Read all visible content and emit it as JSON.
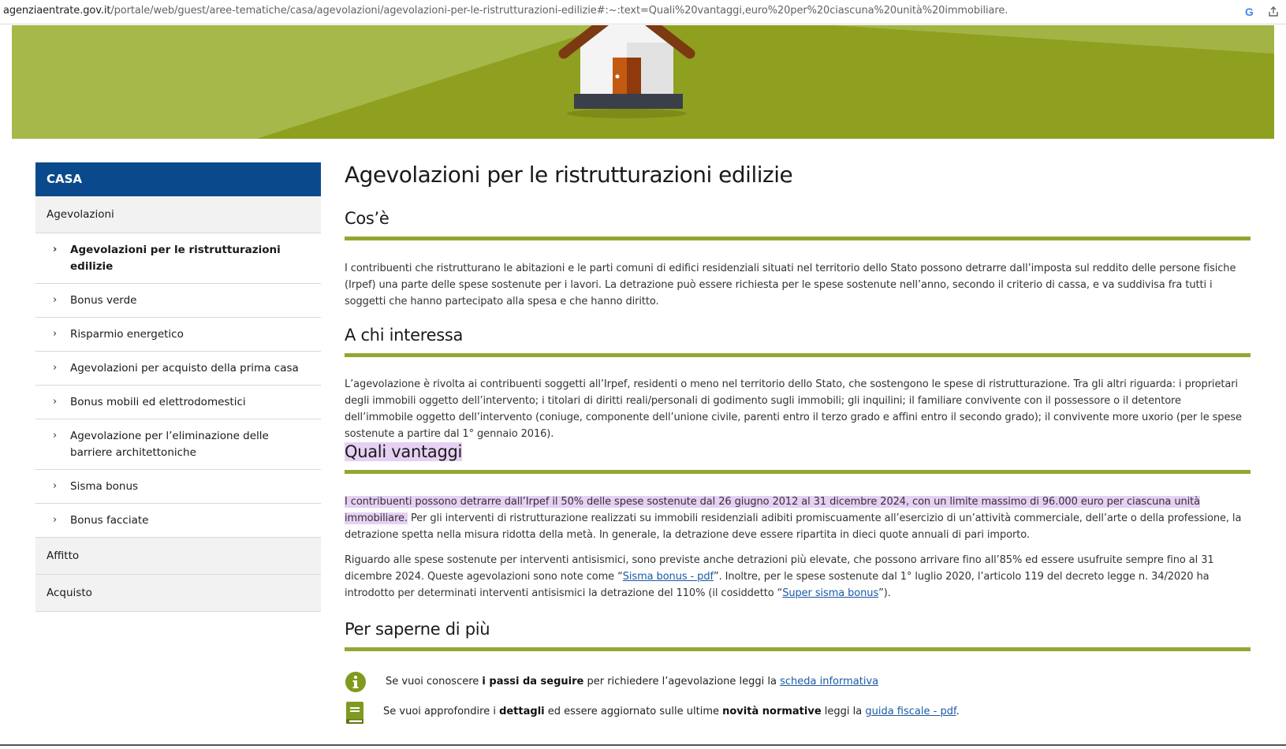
{
  "browser": {
    "url_domain": "agenziaentrate.gov.it",
    "url_path": "/portale/web/guest/aree-tematiche/casa/agevolazioni/agevolazioni-per-le-ristrutturazioni-edilizie#:~:text=Quali%20vantaggi,euro%20per%20ciascuna%20unità%20immobiliare.",
    "google_icon": "G"
  },
  "sidebar": {
    "header": "CASA",
    "items": [
      {
        "label": "Agevolazioni",
        "type": "section"
      },
      {
        "label": "Agevolazioni per le ristrutturazioni edilizie",
        "type": "sub",
        "active": true
      },
      {
        "label": "Bonus verde",
        "type": "sub"
      },
      {
        "label": "Risparmio energetico",
        "type": "sub"
      },
      {
        "label": "Agevolazioni per acquisto della prima casa",
        "type": "sub"
      },
      {
        "label": "Bonus mobili ed elettrodomestici",
        "type": "sub"
      },
      {
        "label": "Agevolazione per l’eliminazione delle barriere architettoniche",
        "type": "sub"
      },
      {
        "label": "Sisma bonus",
        "type": "sub"
      },
      {
        "label": "Bonus facciate",
        "type": "sub"
      },
      {
        "label": "Affitto",
        "type": "section"
      },
      {
        "label": "Acquisto",
        "type": "section"
      }
    ]
  },
  "main": {
    "title": "Agevolazioni per le ristrutturazioni edilizie",
    "cose": {
      "heading": "Cos’è",
      "text": "I contribuenti che ristrutturano le abitazioni e le parti comuni di edifici residenziali situati nel territorio dello Stato possono detrarre dall’imposta sul reddito delle persone fisiche (Irpef) una parte delle spese sostenute per i lavori. La detrazione può essere richiesta per le spese sostenute nell’anno, secondo il criterio di cassa, e va suddivisa fra tutti i soggetti che hanno partecipato alla spesa e che hanno diritto."
    },
    "chi": {
      "heading": "A chi interessa",
      "text": "L’agevolazione è rivolta ai contribuenti soggetti all’Irpef, residenti o meno nel territorio dello Stato, che sostengono le spese di ristrutturazione. Tra gli altri riguarda: i proprietari degli immobili oggetto dell’intervento; i titolari di diritti reali/personali di godimento sugli immobili; gli inquilini; il familiare convivente con il possessore o il detentore dell’immobile oggetto dell’intervento (coniuge, componente dell’unione civile, parenti entro il terzo grado e affini entro il secondo grado); il convivente more uxorio (per le spese sostenute a partire dal 1° gennaio 2016)."
    },
    "vantaggi": {
      "heading": "Quali vantaggi",
      "p1_highlight": "I contribuenti possono detrarre dall’Irpef il 50% delle spese sostenute dal 26 giugno 2012 al 31 dicembre 2024, con un limite massimo di 96.000 euro per ciascuna unità immobiliare.",
      "p1_rest": " Per gli interventi di ristrutturazione realizzati su immobili residenziali adibiti promiscuamente all’esercizio di un’attività commerciale, dell’arte o della professione, la detrazione spetta nella misura ridotta della metà. In generale, la detrazione deve essere ripartita in dieci quote annuali di pari importo.",
      "p2_a": "Riguardo alle spese sostenute per interventi antisismici, sono previste anche detrazioni più elevate, che possono arrivare fino all’85% ed essere usufruite sempre fino al 31 dicembre 2024. Queste agevolazioni sono note come “",
      "p2_link1": "Sisma bonus - pdf",
      "p2_b": "”. Inoltre, per le spese sostenute dal 1° luglio 2020, l’articolo 119 del decreto legge n. 34/2020 ha introdotto per determinati interventi antisismici la detrazione del 110% (il cosiddetto “",
      "p2_link2": "Super sisma bonus",
      "p2_c": "”)."
    },
    "more": {
      "heading": "Per saperne di più",
      "row1_a": "Se vuoi conoscere ",
      "row1_bold": "i passi da seguire",
      "row1_b": " per richiedere l’agevolazione leggi la ",
      "row1_link": "scheda informativa",
      "row2_a": "Se vuoi approfondire i ",
      "row2_bold1": "dettagli",
      "row2_b": " ed essere aggiornato sulle ultime ",
      "row2_bold2": "novità normative",
      "row2_c": " leggi la ",
      "row2_link": "guida fiscale - pdf",
      "row2_d": "."
    }
  },
  "colors": {
    "brand_blue": "#0a4a8c",
    "accent_green": "#94a632",
    "highlight": "#e6d0f4",
    "link": "#1a5aa6"
  }
}
